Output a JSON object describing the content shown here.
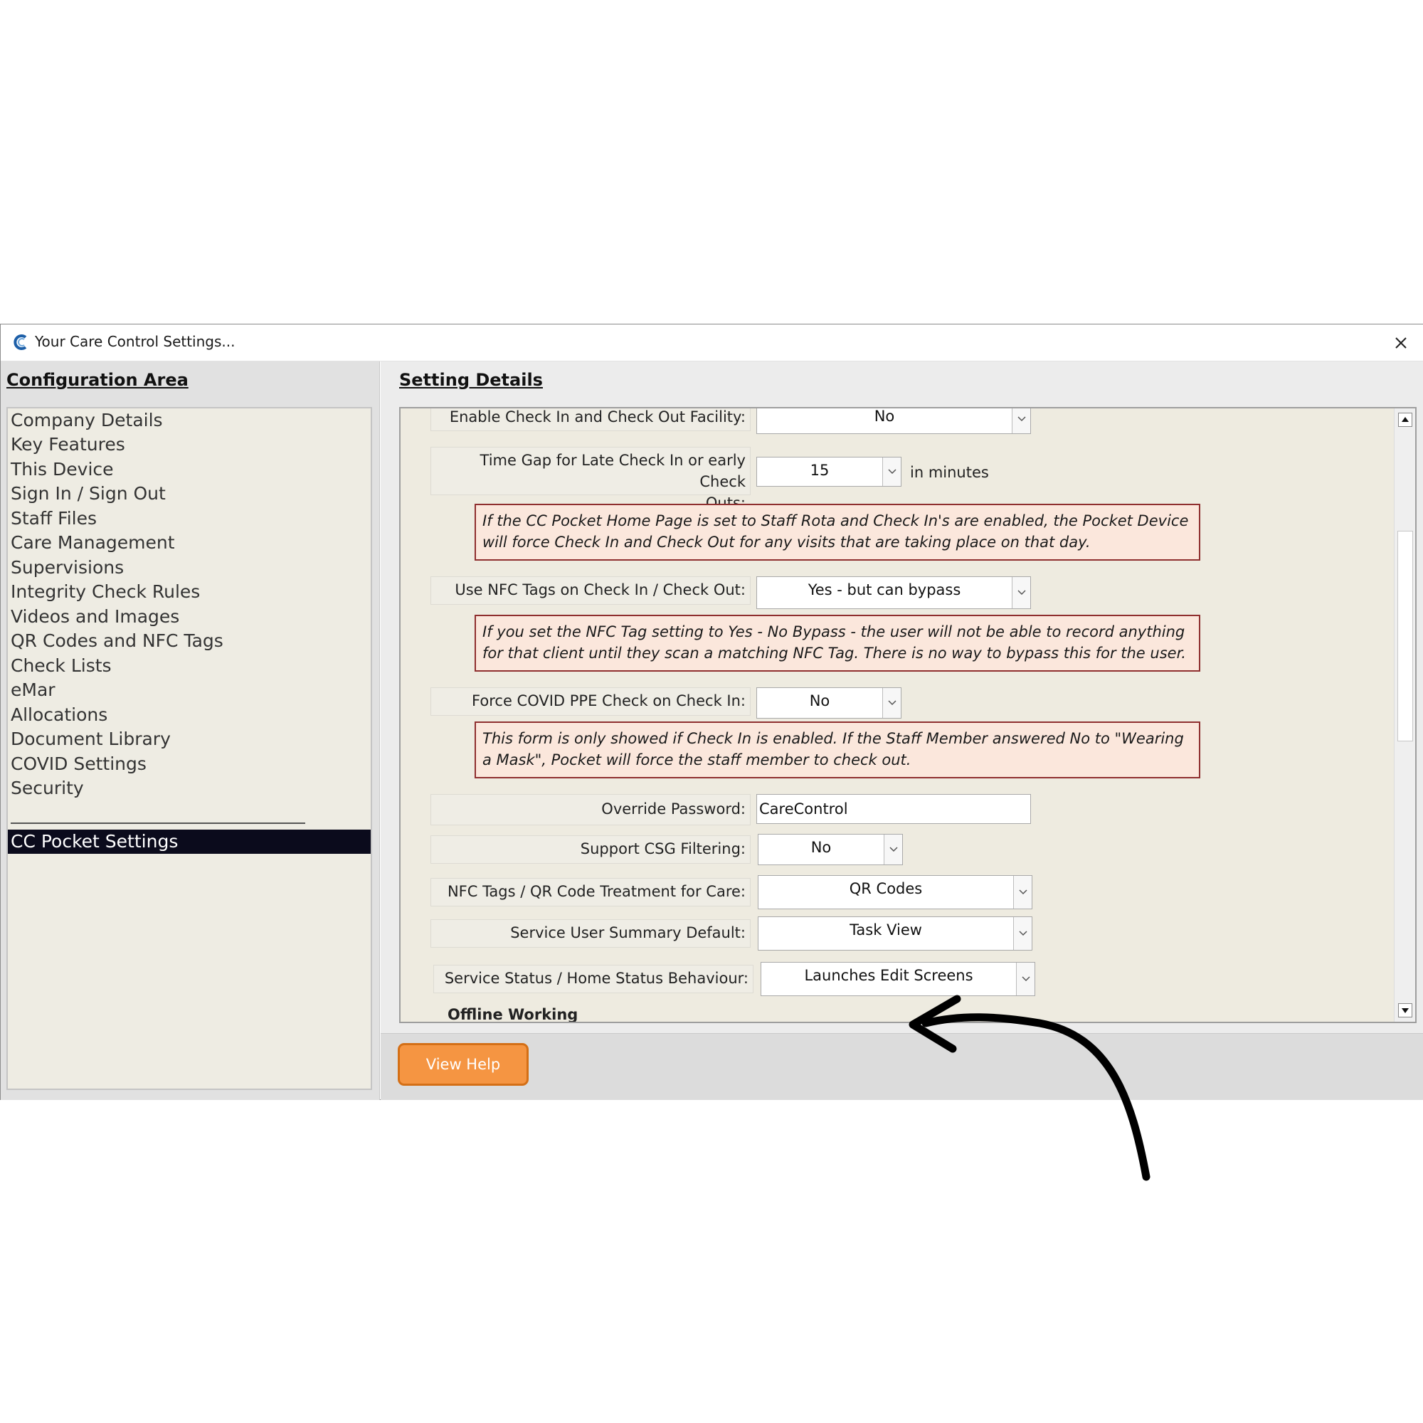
{
  "window": {
    "title": "Your Care Control Settings..."
  },
  "left": {
    "heading": "Configuration Area",
    "items": [
      "Company Details",
      "Key Features",
      "This Device",
      "Sign In / Sign Out",
      "Staff Files",
      "Care Management",
      "Supervisions",
      "Integrity Check Rules",
      "Videos and Images",
      "QR Codes and NFC Tags",
      "Check Lists",
      "eMar",
      "Allocations",
      "Document Library",
      "COVID Settings",
      "Security"
    ],
    "selected": "CC Pocket Settings"
  },
  "right": {
    "heading": "Setting Details",
    "fields": {
      "enable_check_in": {
        "label": "Enable Check In and Check Out Facility:",
        "value": "No"
      },
      "time_gap": {
        "label_line1": "Time Gap for Late Check In or early Check",
        "label_line2": "Outs:",
        "value": "15",
        "unit": "in minutes"
      },
      "nfc_tags": {
        "label": "Use NFC Tags on Check In / Check Out:",
        "value": "Yes - but can bypass"
      },
      "covid_ppe": {
        "label": "Force COVID PPE Check on Check In:",
        "value": "No"
      },
      "override_password": {
        "label": "Override Password:",
        "value": "CareControl"
      },
      "csg_filtering": {
        "label": "Support CSG Filtering:",
        "value": "No"
      },
      "nfc_qr_treatment": {
        "label": "NFC Tags / QR Code Treatment for Care:",
        "value": "QR Codes"
      },
      "service_user_summary": {
        "label": "Service User Summary Default:",
        "value": "Task View"
      },
      "service_status": {
        "label": "Service Status / Home Status Behaviour:",
        "value": "Launches Edit Screens"
      }
    },
    "notes": {
      "home_page": "If the CC Pocket Home Page is set to Staff Rota and Check In's are enabled, the Pocket Device will force Check In and Check Out for any visits that are taking place on that day.",
      "nfc": "If you set the NFC Tag setting to Yes - No Bypass - the user will not be able to record anything for that client until they scan a matching NFC Tag.  There is no way to bypass this for the user.",
      "covid": "This form is only showed if Check In is enabled.  If the Staff Member answered No to \"Wearing a Mask\", Pocket will force the staff member to check out."
    },
    "section_offline": "Offline Working",
    "help_button": "View Help"
  },
  "colors": {
    "accent_orange": "#f59542",
    "note_background": "#fbe7dc",
    "note_border": "#8f2f2f",
    "selected_background": "#0b0b1c"
  }
}
